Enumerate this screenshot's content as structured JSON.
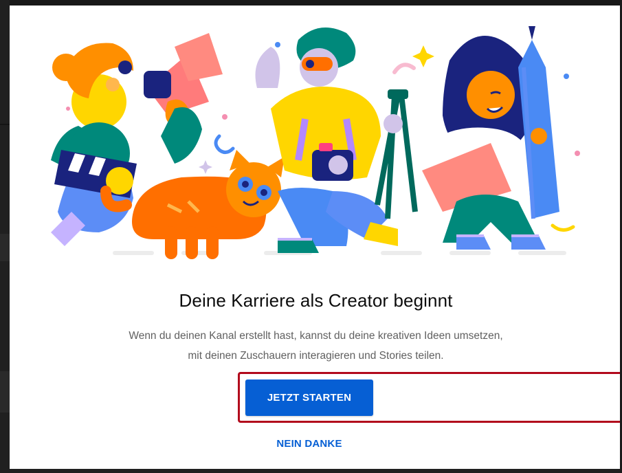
{
  "dialog": {
    "title": "Deine Karriere als Creator beginnt",
    "description_line1": "Wenn du deinen Kanal erstellt hast, kannst du deine kreativen Ideen umsetzen,",
    "description_line2": "mit deinen Zuschauern interagieren und Stories teilen.",
    "primary_button": "JETZT STARTEN",
    "secondary_button": "NEIN DANKE",
    "illustration": "creators-illustration"
  },
  "colors": {
    "accent": "#065fd4",
    "highlight_border": "#b2091c",
    "title": "#0d0d0d",
    "description": "#606060"
  }
}
